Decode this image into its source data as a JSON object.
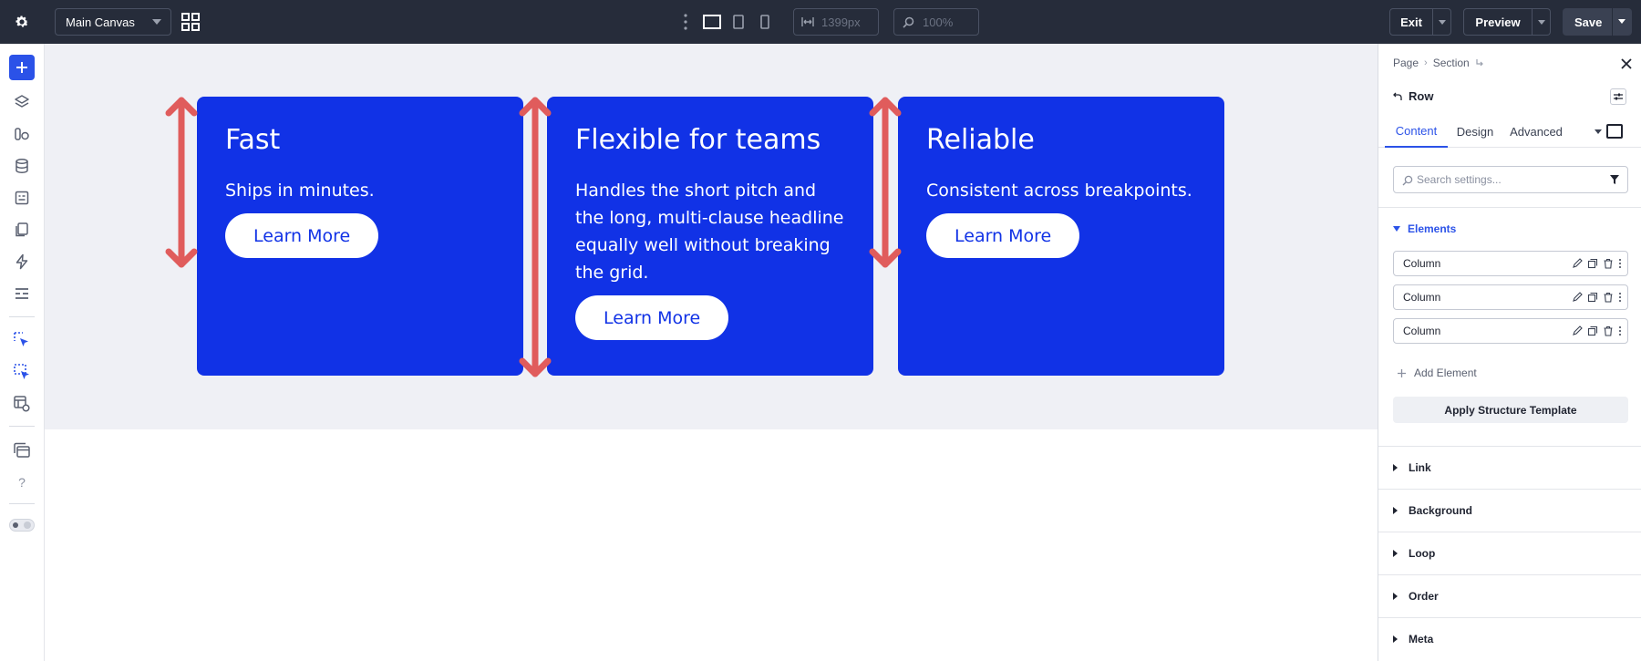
{
  "topbar": {
    "gear_icon": "gear-icon",
    "canvas_select": "Main Canvas",
    "layout_icon": "grid-layout-icon",
    "width_value": "1399px",
    "zoom_value": "100%",
    "exit_label": "Exit",
    "preview_label": "Preview",
    "save_label": "Save"
  },
  "rail": {
    "icons": [
      "plus-icon",
      "layers-icon",
      "shapes-icon",
      "database-icon",
      "form-icon",
      "pages-icon",
      "lightning-icon",
      "sections-icon",
      "select-element-icon",
      "select-multiple-icon",
      "template-settings-icon",
      "windows-icon",
      "help-icon",
      "theme-toggle"
    ],
    "help_glyph": "?"
  },
  "canvas": {
    "cards": [
      {
        "title": "Fast",
        "body": "Ships in minutes.",
        "cta": "Learn More"
      },
      {
        "title": "Flexible for teams",
        "body": "Handles the short pitch and the long, multi-clause headline equally well without breaking the grid.",
        "cta": "Learn More"
      },
      {
        "title": "Reliable",
        "body": "Consistent across breakpoints.",
        "cta": "Learn More"
      }
    ],
    "card_color": "#1132e6",
    "arrow_color": "#e05c5c"
  },
  "panel": {
    "breadcrumb": [
      "Page",
      "Section"
    ],
    "element_label": "Row",
    "tabs": [
      "Content",
      "Design",
      "Advanced"
    ],
    "active_tab": "Content",
    "search_placeholder": "Search settings...",
    "elements_heading": "Elements",
    "columns": [
      "Column",
      "Column",
      "Column"
    ],
    "add_element": "Add Element",
    "apply_template": "Apply Structure Template",
    "sections": [
      "Link",
      "Background",
      "Loop",
      "Order",
      "Meta"
    ],
    "accent": "#2b52e8"
  }
}
